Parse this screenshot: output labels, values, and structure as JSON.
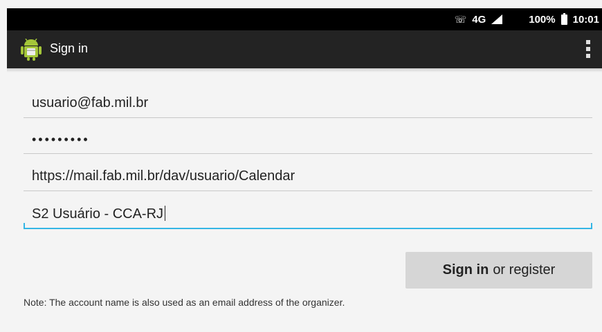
{
  "status_bar": {
    "call_icon": "wifi-calling-icon",
    "network": "4G",
    "signal_icon": "cellular-signal-icon",
    "battery_percent": "100%",
    "battery_icon": "battery-icon",
    "time": "10:01"
  },
  "action_bar": {
    "app_icon": "android-app-icon",
    "title": "Sign in",
    "overflow_icon": "overflow-menu-icon"
  },
  "form": {
    "email": "usuario@fab.mil.br",
    "password_masked": "•••••••••",
    "url": "https://mail.fab.mil.br/dav/usuario/Calendar",
    "account_name": "S2 Usuário - CCA-RJ"
  },
  "button": {
    "bold_text": "Sign in",
    "rest_text": "or register"
  },
  "note": "Note: The account name is also used as an email address of the organizer.",
  "colors": {
    "status_bar": "#000000",
    "action_bar": "#232323",
    "background": "#f4f4f4",
    "focus_accent": "#33b5e5",
    "button": "#d6d6d6",
    "android_green": "#a4c639"
  }
}
